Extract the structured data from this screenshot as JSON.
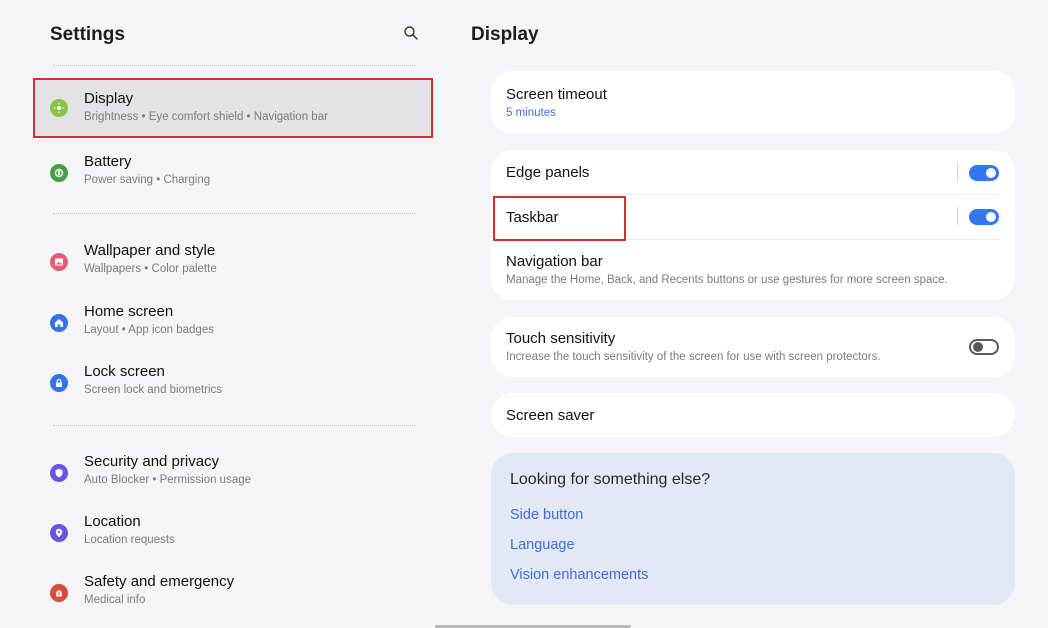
{
  "left": {
    "title": "Settings",
    "items": [
      {
        "label": "Display",
        "sub": "Brightness  •  Eye comfort shield  •  Navigation bar",
        "icon": "display-icon",
        "color": "#8bc34a"
      },
      {
        "label": "Battery",
        "sub": "Power saving  •  Charging",
        "icon": "battery-icon",
        "color": "#43a047"
      },
      {
        "label": "Wallpaper and style",
        "sub": "Wallpapers  •  Color palette",
        "icon": "wallpaper-icon",
        "color": "#e35d77"
      },
      {
        "label": "Home screen",
        "sub": "Layout  •  App icon badges",
        "icon": "home-icon",
        "color": "#3574e8"
      },
      {
        "label": "Lock screen",
        "sub": "Screen lock and biometrics",
        "icon": "lock-icon",
        "color": "#3574e8"
      },
      {
        "label": "Security and privacy",
        "sub": "Auto Blocker  •  Permission usage",
        "icon": "shield-icon",
        "color": "#6a55e0"
      },
      {
        "label": "Location",
        "sub": "Location requests",
        "icon": "location-pin-icon",
        "color": "#6a55e0"
      },
      {
        "label": "Safety and emergency",
        "sub": "Medical info",
        "icon": "emergency-icon",
        "color": "#d84c3a"
      }
    ]
  },
  "right": {
    "title": "Display",
    "screen_timeout": {
      "label": "Screen timeout",
      "value": "5 minutes"
    },
    "edge_panels": {
      "label": "Edge panels",
      "toggle": "on"
    },
    "taskbar": {
      "label": "Taskbar",
      "toggle": "on"
    },
    "navigation_bar": {
      "label": "Navigation bar",
      "sub": "Manage the Home, Back, and Recents buttons or use gestures for more screen space."
    },
    "touch_sensitivity": {
      "label": "Touch sensitivity",
      "sub": "Increase the touch sensitivity of the screen for use with screen protectors.",
      "toggle": "off"
    },
    "screen_saver": {
      "label": "Screen saver"
    },
    "suggestions": {
      "question": "Looking for something else?",
      "links": [
        "Side button",
        "Language",
        "Vision enhancements"
      ]
    }
  },
  "colors": {
    "accent": "#3478f0",
    "link": "#3a6fd8",
    "highlight": "#d32f2f"
  }
}
